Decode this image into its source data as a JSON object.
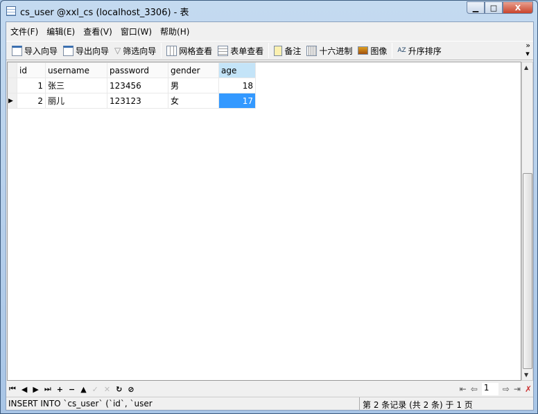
{
  "window": {
    "title": "cs_user @xxl_cs (localhost_3306) - 表",
    "minimize": "▁",
    "maximize": "□",
    "close": "X"
  },
  "menu": [
    "文件(F)",
    "编辑(E)",
    "查看(V)",
    "窗口(W)",
    "帮助(H)"
  ],
  "toolbar": {
    "import": "导入向导",
    "export": "导出向导",
    "filter": "筛选向导",
    "grid_view": "网格查看",
    "form_view": "表单查看",
    "memo": "备注",
    "hex": "十六进制",
    "image": "图像",
    "sort_asc": "升序排序",
    "more": "»"
  },
  "table": {
    "columns": [
      "id",
      "username",
      "password",
      "gender",
      "age"
    ],
    "rows": [
      {
        "id": "1",
        "username": "张三",
        "password": "123456",
        "gender": "男",
        "age": "18"
      },
      {
        "id": "2",
        "username": "丽儿",
        "password": "123123",
        "gender": "女",
        "age": "17"
      }
    ]
  },
  "nav": {
    "buttons": [
      "⏮",
      "◀",
      "▶",
      "⏭",
      "+",
      "−",
      "▲",
      "✓",
      "✕",
      "↻",
      "⊘"
    ],
    "page": "1"
  },
  "status": {
    "sql": "INSERT INTO `cs_user` (`id`, `user",
    "record": "第 2 条记录 (共 2 条) 于 1 页"
  }
}
